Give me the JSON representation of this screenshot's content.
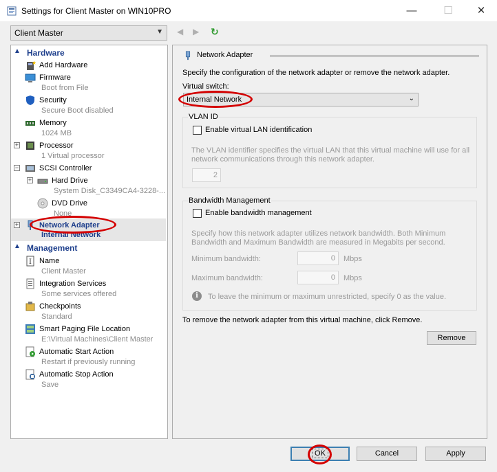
{
  "window": {
    "title": "Settings for Client Master on WIN10PRO",
    "minimize_glyph": "—",
    "maximize_glyph": "☐",
    "close_glyph": "✕"
  },
  "toolbar": {
    "vm_selected": "Client Master",
    "back_glyph": "◀",
    "forward_glyph": "▶",
    "refresh_glyph": "↻"
  },
  "sidebar": {
    "hardware_header": "Hardware",
    "management_header": "Management",
    "hardware_items": [
      {
        "name": "Add Hardware",
        "sub": "",
        "icon": "add-hardware-icon"
      },
      {
        "name": "Firmware",
        "sub": "Boot from File",
        "icon": "firmware-icon"
      },
      {
        "name": "Security",
        "sub": "Secure Boot disabled",
        "icon": "shield-icon"
      },
      {
        "name": "Memory",
        "sub": "1024 MB",
        "icon": "memory-icon"
      },
      {
        "name": "Processor",
        "sub": "1 Virtual processor",
        "icon": "processor-icon"
      },
      {
        "name": "SCSI Controller",
        "sub": "",
        "icon": "scsi-controller-icon"
      },
      {
        "name": "Hard Drive",
        "sub": "System Disk_C3349CA4-3228-...",
        "icon": "hard-drive-icon"
      },
      {
        "name": "DVD Drive",
        "sub": "None",
        "icon": "dvd-drive-icon"
      },
      {
        "name": "Network Adapter",
        "sub": "Internal Network",
        "icon": "network-adapter-icon"
      }
    ],
    "management_items": [
      {
        "name": "Name",
        "sub": "Client Master",
        "icon": "name-icon"
      },
      {
        "name": "Integration Services",
        "sub": "Some services offered",
        "icon": "integration-services-icon"
      },
      {
        "name": "Checkpoints",
        "sub": "Standard",
        "icon": "checkpoints-icon"
      },
      {
        "name": "Smart Paging File Location",
        "sub": "E:\\Virtual Machines\\Client Master",
        "icon": "smart-paging-icon"
      },
      {
        "name": "Automatic Start Action",
        "sub": "Restart if previously running",
        "icon": "auto-start-icon"
      },
      {
        "name": "Automatic Stop Action",
        "sub": "Save",
        "icon": "auto-stop-icon"
      }
    ]
  },
  "main": {
    "section_title": "Network Adapter",
    "description": "Specify the configuration of the network adapter or remove the network adapter.",
    "virtual_switch_label": "Virtual switch:",
    "virtual_switch_value": "Internal Network",
    "vlan": {
      "title": "VLAN ID",
      "checkbox_label": "Enable virtual LAN identification",
      "help_line1": "The VLAN identifier specifies the virtual LAN that this virtual machine will use for all",
      "help_line2": "network communications through this network adapter.",
      "value": "2"
    },
    "bandwidth": {
      "title": "Bandwidth Management",
      "checkbox_label": "Enable bandwidth management",
      "help_line1": "Specify how this network adapter utilizes network bandwidth. Both Minimum",
      "help_line2": "Bandwidth and Maximum Bandwidth are measured in Megabits per second.",
      "min_label": "Minimum bandwidth:",
      "min_value": "0",
      "max_label": "Maximum bandwidth:",
      "max_value": "0",
      "unit": "Mbps",
      "info_glyph": "i",
      "info_text": "To leave the minimum or maximum unrestricted, specify 0 as the value."
    },
    "remove_text": "To remove the network adapter from this virtual machine, click Remove.",
    "remove_button": "Remove"
  },
  "footer": {
    "ok": "OK",
    "cancel": "Cancel",
    "apply": "Apply"
  },
  "colors": {
    "accent": "#1e3f8c",
    "highlight_oval": "#d40000"
  }
}
